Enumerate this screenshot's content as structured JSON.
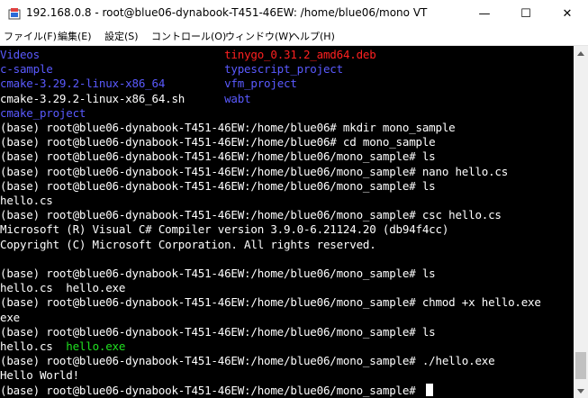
{
  "window": {
    "title": "192.168.0.8 - root@blue06-dynabook-T451-46EW: /home/blue06/mono VT",
    "app_icon": "teraterm-icon",
    "minimize_glyph": "—",
    "maximize_glyph": "☐",
    "close_glyph": "✕"
  },
  "menu": {
    "items": [
      {
        "label": "ファイル(F)"
      },
      {
        "label": "編集(E)"
      },
      {
        "label": "設定(S)"
      },
      {
        "label": "コントロール(O)"
      },
      {
        "label": "ウィンドウ(W)"
      },
      {
        "label": "ヘルプ(H)"
      }
    ]
  },
  "terminal": {
    "colors": {
      "default": "#ffffff",
      "dir": "#5a5aff",
      "red": "#ff2020",
      "exe": "#20e020",
      "background": "#000000"
    },
    "lines": [
      {
        "segments": [
          {
            "text": "Videos",
            "color": "dir"
          },
          {
            "text": "                            ",
            "color": "default"
          },
          {
            "text": "tinygo_0.31.2_amd64.deb",
            "color": "red"
          }
        ]
      },
      {
        "segments": [
          {
            "text": "c-sample",
            "color": "dir"
          },
          {
            "text": "                          ",
            "color": "default"
          },
          {
            "text": "typescript_project",
            "color": "dir"
          }
        ]
      },
      {
        "segments": [
          {
            "text": "cmake-3.29.2-linux-x86_64",
            "color": "dir"
          },
          {
            "text": "         ",
            "color": "default"
          },
          {
            "text": "vfm_project",
            "color": "dir"
          }
        ]
      },
      {
        "segments": [
          {
            "text": "cmake-3.29.2-linux-x86_64.sh",
            "color": "default"
          },
          {
            "text": "      ",
            "color": "default"
          },
          {
            "text": "wabt",
            "color": "dir"
          }
        ]
      },
      {
        "segments": [
          {
            "text": "cmake_project",
            "color": "dir"
          }
        ]
      },
      {
        "segments": [
          {
            "text": "(base) root@blue06-dynabook-T451-46EW:/home/blue06# mkdir mono_sample",
            "color": "default"
          }
        ]
      },
      {
        "segments": [
          {
            "text": "(base) root@blue06-dynabook-T451-46EW:/home/blue06# cd mono_sample",
            "color": "default"
          }
        ]
      },
      {
        "segments": [
          {
            "text": "(base) root@blue06-dynabook-T451-46EW:/home/blue06/mono_sample# ls",
            "color": "default"
          }
        ]
      },
      {
        "segments": [
          {
            "text": "(base) root@blue06-dynabook-T451-46EW:/home/blue06/mono_sample# nano hello.cs",
            "color": "default"
          }
        ]
      },
      {
        "segments": [
          {
            "text": "(base) root@blue06-dynabook-T451-46EW:/home/blue06/mono_sample# ls",
            "color": "default"
          }
        ]
      },
      {
        "segments": [
          {
            "text": "hello.cs",
            "color": "default"
          }
        ]
      },
      {
        "segments": [
          {
            "text": "(base) root@blue06-dynabook-T451-46EW:/home/blue06/mono_sample# csc hello.cs",
            "color": "default"
          }
        ]
      },
      {
        "segments": [
          {
            "text": "Microsoft (R) Visual C# Compiler version 3.9.0-6.21124.20 (db94f4cc)",
            "color": "default"
          }
        ]
      },
      {
        "segments": [
          {
            "text": "Copyright (C) Microsoft Corporation. All rights reserved.",
            "color": "default"
          }
        ]
      },
      {
        "segments": [
          {
            "text": "",
            "color": "default"
          }
        ]
      },
      {
        "segments": [
          {
            "text": "(base) root@blue06-dynabook-T451-46EW:/home/blue06/mono_sample# ls",
            "color": "default"
          }
        ]
      },
      {
        "segments": [
          {
            "text": "hello.cs  hello.exe",
            "color": "default"
          }
        ]
      },
      {
        "segments": [
          {
            "text": "(base) root@blue06-dynabook-T451-46EW:/home/blue06/mono_sample# chmod +x hello.exe",
            "color": "default"
          }
        ]
      },
      {
        "segments": [
          {
            "text": "exe",
            "color": "default"
          }
        ]
      },
      {
        "segments": [
          {
            "text": "(base) root@blue06-dynabook-T451-46EW:/home/blue06/mono_sample# ls",
            "color": "default"
          }
        ]
      },
      {
        "segments": [
          {
            "text": "hello.cs  ",
            "color": "default"
          },
          {
            "text": "hello.exe",
            "color": "exe"
          }
        ]
      },
      {
        "segments": [
          {
            "text": "(base) root@blue06-dynabook-T451-46EW:/home/blue06/mono_sample# ./hello.exe",
            "color": "default"
          }
        ]
      },
      {
        "segments": [
          {
            "text": "Hello World!",
            "color": "default"
          }
        ]
      },
      {
        "segments": [
          {
            "text": "(base) root@blue06-dynabook-T451-46EW:/home/blue06/mono_sample# ",
            "color": "default"
          }
        ],
        "cursor": true
      }
    ]
  }
}
